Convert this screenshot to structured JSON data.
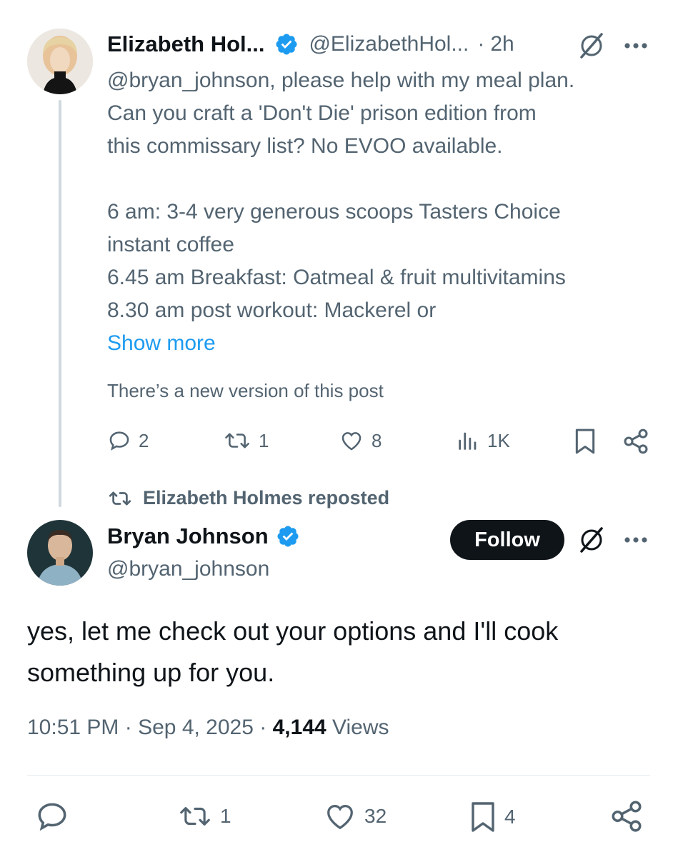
{
  "quoted_post": {
    "author_name": "Elizabeth Hol...",
    "author_handle": "@ElizabethHol...",
    "time_separator": "·",
    "time": "2h",
    "text_lines": [
      "@bryan_johnson, please help with my meal plan.",
      "Can you craft a 'Don't Die' prison edition from",
      "this commissary list? No EVOO available.",
      "",
      "6 am: 3-4 very generous scoops Tasters Choice",
      "instant coffee",
      "6.45 am Breakfast: Oatmeal & fruit multivitamins",
      "8.30 am post workout: Mackerel or"
    ],
    "show_more": "Show more",
    "new_version_notice": "There’s a new version of this post",
    "actions": {
      "replies": "2",
      "reposts": "1",
      "likes": "8",
      "views": "1K"
    }
  },
  "repost_notice": "Elizabeth Holmes reposted",
  "main_post": {
    "author_name": "Bryan Johnson",
    "author_handle": "@bryan_johnson",
    "follow_label": "Follow",
    "text_lines": [
      "yes, let me check out your options and I'll cook",
      "something up for you."
    ],
    "time": "10:51 PM",
    "sep1": "·",
    "date": "Sep 4, 2025",
    "sep2": "·",
    "views_count": "4,144",
    "views_label": "Views",
    "actions": {
      "reposts": "1",
      "likes": "32",
      "bookmarks": "4"
    }
  },
  "colors": {
    "accent": "#1d9bf0",
    "muted": "#536471",
    "text": "#0f1419"
  },
  "icons": [
    "verified-badge-icon",
    "grok-icon",
    "more-icon",
    "reply-icon",
    "repost-icon",
    "like-icon",
    "views-icon",
    "bookmark-icon",
    "share-icon"
  ]
}
